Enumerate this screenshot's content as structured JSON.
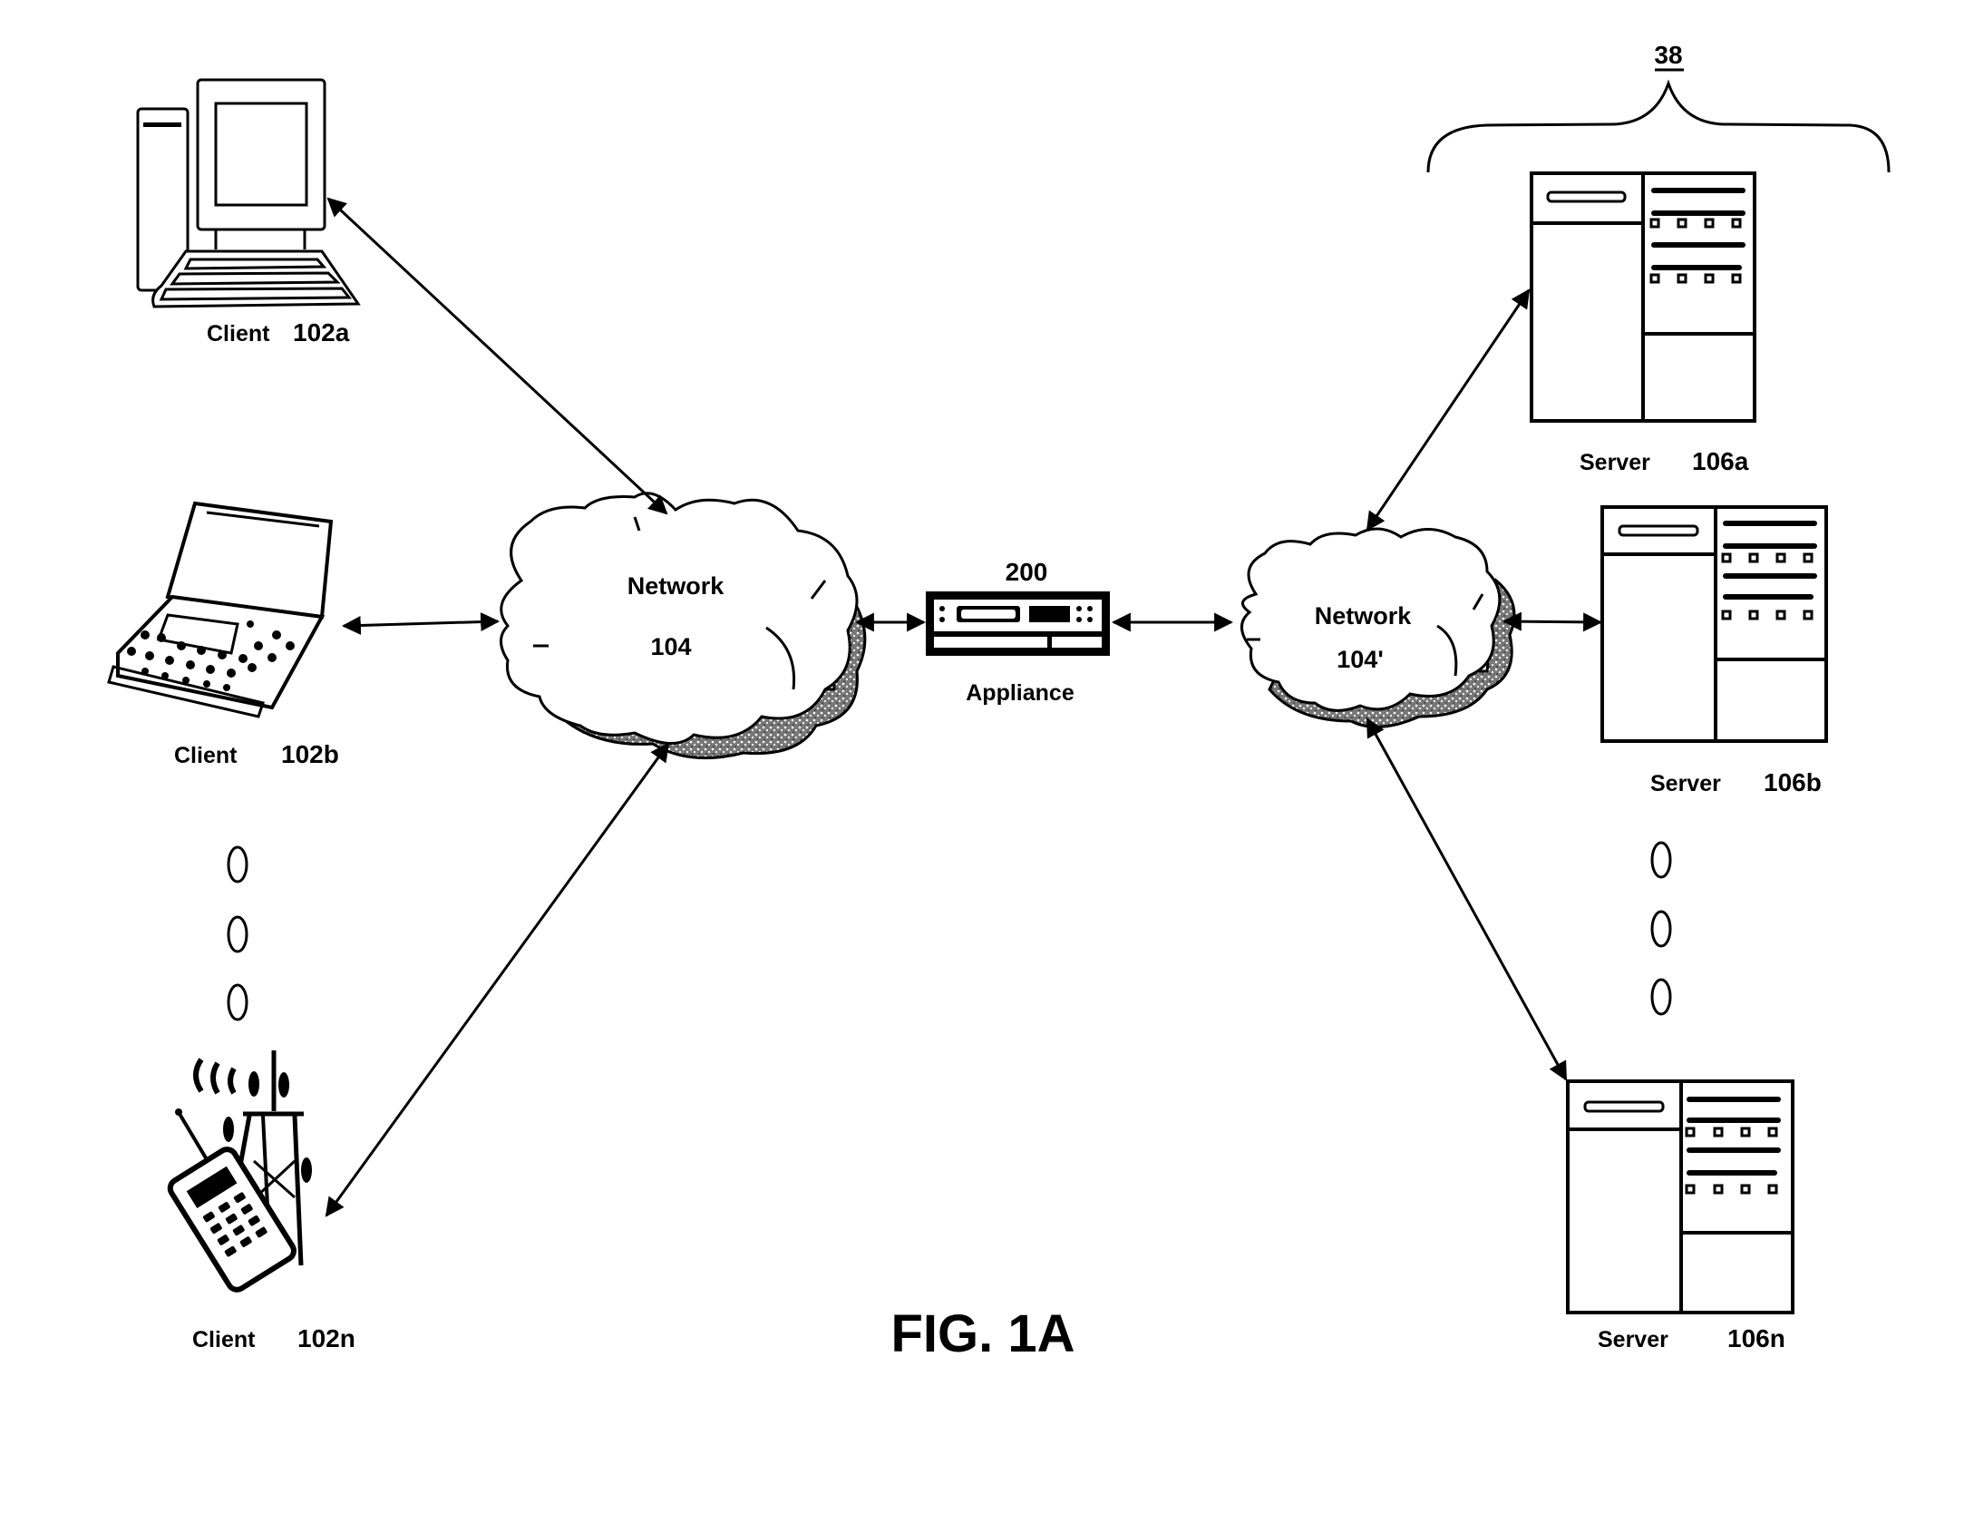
{
  "figure": {
    "title": "FIG. 1A",
    "group_ref": "38"
  },
  "clients": [
    {
      "label": "Client",
      "ref": "102a",
      "icon": "desktop-computer-icon"
    },
    {
      "label": "Client",
      "ref": "102b",
      "icon": "laptop-icon"
    },
    {
      "label": "Client",
      "ref": "102n",
      "icon": "mobile-phone-tower-icon"
    }
  ],
  "networks": [
    {
      "label": "Network",
      "ref": "104"
    },
    {
      "label": "Network",
      "ref": "104'"
    }
  ],
  "appliance": {
    "label": "Appliance",
    "ref": "200",
    "icon": "appliance-icon"
  },
  "servers": [
    {
      "label": "Server",
      "ref": "106a",
      "icon": "server-icon"
    },
    {
      "label": "Server",
      "ref": "106b",
      "icon": "server-icon"
    },
    {
      "label": "Server",
      "ref": "106n",
      "icon": "server-icon"
    }
  ],
  "connections": [
    {
      "from": "102a",
      "to": "104",
      "bidirectional": true
    },
    {
      "from": "102b",
      "to": "104",
      "bidirectional": true
    },
    {
      "from": "102n",
      "to": "104",
      "bidirectional": true
    },
    {
      "from": "104",
      "to": "200",
      "bidirectional": true
    },
    {
      "from": "200",
      "to": "104'",
      "bidirectional": true
    },
    {
      "from": "104'",
      "to": "106a",
      "bidirectional": true
    },
    {
      "from": "104'",
      "to": "106b",
      "bidirectional": true
    },
    {
      "from": "104'",
      "to": "106n",
      "bidirectional": true
    }
  ],
  "ellipsis": {
    "symbol": "0",
    "count": 3
  }
}
